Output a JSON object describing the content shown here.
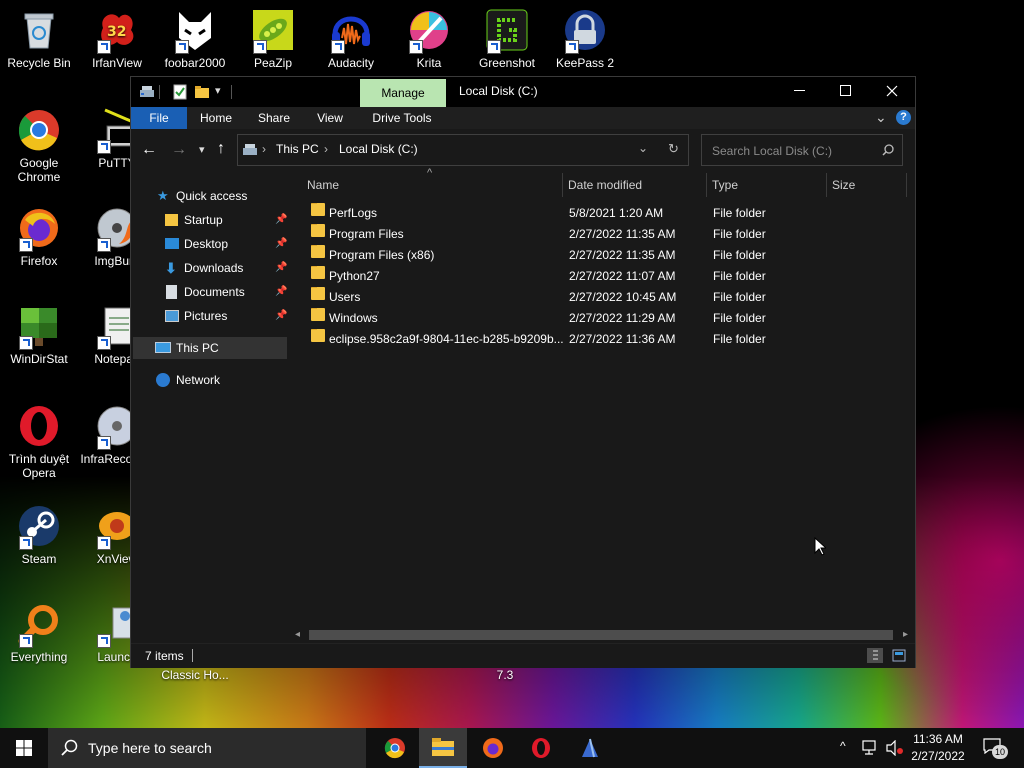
{
  "desktop": {
    "icons": [
      {
        "label": "Recycle Bin"
      },
      {
        "label": "IrfanView",
        "badge": "32"
      },
      {
        "label": "foobar2000"
      },
      {
        "label": "PeaZip"
      },
      {
        "label": "Audacity"
      },
      {
        "label": "Krita"
      },
      {
        "label": "Greenshot"
      },
      {
        "label": "KeePass 2"
      },
      {
        "label": "Google Chrome"
      },
      {
        "label": "PuTTY"
      },
      {
        "label": "Firefox"
      },
      {
        "label": "ImgBurn"
      },
      {
        "label": "WinDirStat"
      },
      {
        "label": "Notepad"
      },
      {
        "label": "Trình duyệt Opera"
      },
      {
        "label": "InfraRecorder"
      },
      {
        "label": "Steam"
      },
      {
        "label": "XnView"
      },
      {
        "label": "Everything"
      },
      {
        "label": "Launch"
      }
    ],
    "partial_labels": {
      "classic": "Classic Ho...",
      "version": "7.3"
    },
    "colors": {
      "accent": "#1a5fd0"
    }
  },
  "explorer": {
    "title": "Local Disk (C:)",
    "manage_tab": "Manage",
    "drive_tools_tab": "Drive Tools",
    "ribbon_tabs": [
      "File",
      "Home",
      "Share",
      "View"
    ],
    "address": {
      "root": "This PC",
      "current": "Local Disk (C:)"
    },
    "search_placeholder": "Search Local Disk (C:)",
    "nav": {
      "quick_access": "Quick access",
      "pinned": [
        "Startup",
        "Desktop",
        "Downloads",
        "Documents",
        "Pictures"
      ],
      "this_pc": "This PC",
      "network": "Network"
    },
    "columns": {
      "name": "Name",
      "date": "Date modified",
      "type": "Type",
      "size": "Size"
    },
    "files": [
      {
        "name": "PerfLogs",
        "date": "5/8/2021 1:20 AM",
        "type": "File folder"
      },
      {
        "name": "Program Files",
        "date": "2/27/2022 11:35 AM",
        "type": "File folder"
      },
      {
        "name": "Program Files (x86)",
        "date": "2/27/2022 11:35 AM",
        "type": "File folder"
      },
      {
        "name": "Python27",
        "date": "2/27/2022 11:07 AM",
        "type": "File folder"
      },
      {
        "name": "Users",
        "date": "2/27/2022 10:45 AM",
        "type": "File folder"
      },
      {
        "name": "Windows",
        "date": "2/27/2022 11:29 AM",
        "type": "File folder"
      },
      {
        "name": "eclipse.958c2a9f-9804-11ec-b285-b9209b...",
        "date": "2/27/2022 11:36 AM",
        "type": "File folder"
      }
    ],
    "status": "7 items",
    "colors": {
      "manage_tab_bg": "#b9e5b1",
      "file_tab_bg": "#1a5fb4",
      "selection": "#333333"
    }
  },
  "taskbar": {
    "search_placeholder": "Type here to search",
    "time": "11:36 AM",
    "date": "2/27/2022",
    "notifications": "10"
  }
}
